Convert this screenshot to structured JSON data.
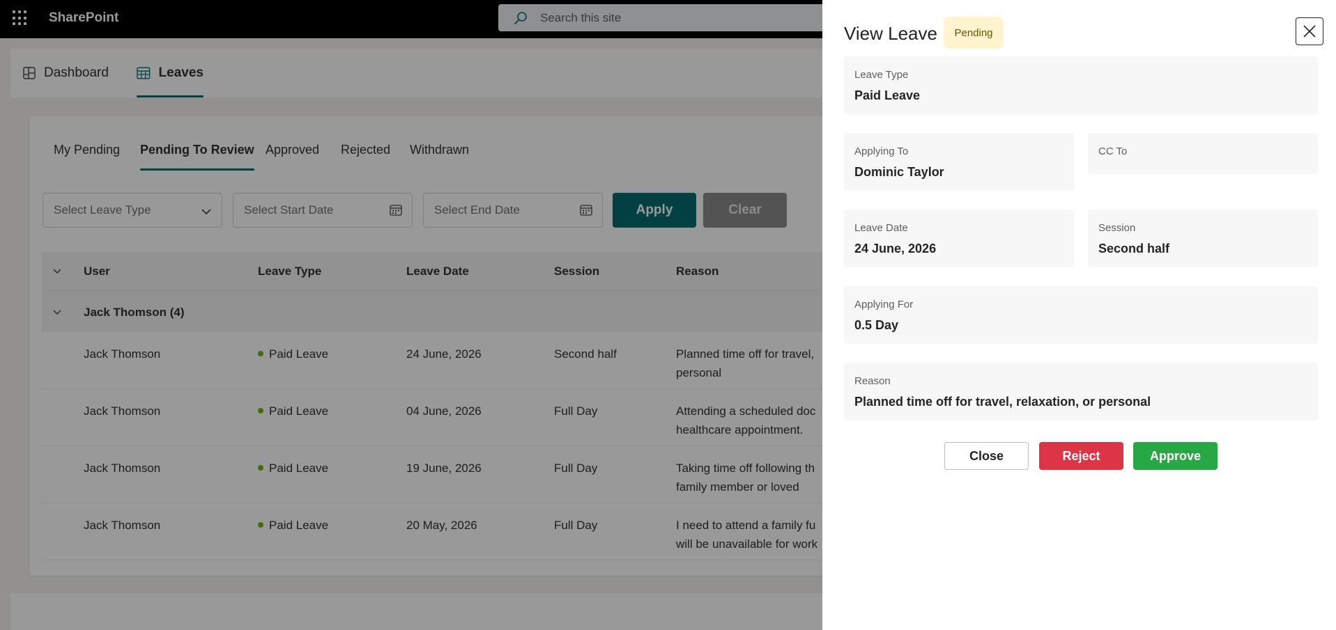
{
  "suitebar": {
    "brand": "SharePoint",
    "search_placeholder": "Search this site"
  },
  "nav": {
    "items": [
      {
        "label": "Dashboard"
      },
      {
        "label": "Leaves"
      }
    ]
  },
  "tabs": [
    {
      "label": "My Pending"
    },
    {
      "label": "Pending To Review"
    },
    {
      "label": "Approved"
    },
    {
      "label": "Rejected"
    },
    {
      "label": "Withdrawn"
    }
  ],
  "filters": {
    "leave_type_placeholder": "Select Leave Type",
    "start_date_placeholder": "Select Start Date",
    "end_date_placeholder": "Select End Date",
    "apply_label": "Apply",
    "clear_label": "Clear"
  },
  "table": {
    "columns": [
      "User",
      "Leave Type",
      "Leave Date",
      "Session",
      "Reason"
    ],
    "group_label": "Jack Thomson (4)",
    "leave_dot_color": "#6bb700",
    "rows": [
      {
        "user": "Jack Thomson",
        "leave_type": "Paid Leave",
        "date": "24 June, 2026",
        "session": "Second half",
        "reason_l1": "Planned time off for travel,",
        "reason_l2": "personal"
      },
      {
        "user": "Jack Thomson",
        "leave_type": "Paid Leave",
        "date": "04 June, 2026",
        "session": "Full Day",
        "reason_l1": "Attending a scheduled doc",
        "reason_l2": "healthcare appointment."
      },
      {
        "user": "Jack Thomson",
        "leave_type": "Paid Leave",
        "date": "19 June, 2026",
        "session": "Full Day",
        "reason_l1": "Taking time off following th",
        "reason_l2": "family member or loved"
      },
      {
        "user": "Jack Thomson",
        "leave_type": "Paid Leave",
        "date": "20 May, 2026",
        "session": "Full Day",
        "reason_l1": "I need to attend a family fu",
        "reason_l2": "will be unavailable for work"
      }
    ]
  },
  "panel": {
    "title": "View Leave",
    "status": "Pending",
    "fields": {
      "leave_type": {
        "label": "Leave Type",
        "value": "Paid Leave"
      },
      "applying_to": {
        "label": "Applying To",
        "value": "Dominic Taylor"
      },
      "cc_to": {
        "label": "CC To",
        "value": ""
      },
      "leave_date": {
        "label": "Leave Date",
        "value": "24 June, 2026"
      },
      "session": {
        "label": "Session",
        "value": "Second half"
      },
      "applying_for": {
        "label": "Applying For",
        "value": "0.5 Day"
      },
      "reason": {
        "label": "Reason",
        "value": "Planned time off for travel, relaxation, or personal"
      }
    },
    "buttons": {
      "close": "Close",
      "reject": "Reject",
      "approve": "Approve"
    }
  },
  "colors": {
    "accent": "#036c70",
    "reject": "#dc3545",
    "approve": "#28a745",
    "pending_badge_bg": "#fff4ce"
  }
}
